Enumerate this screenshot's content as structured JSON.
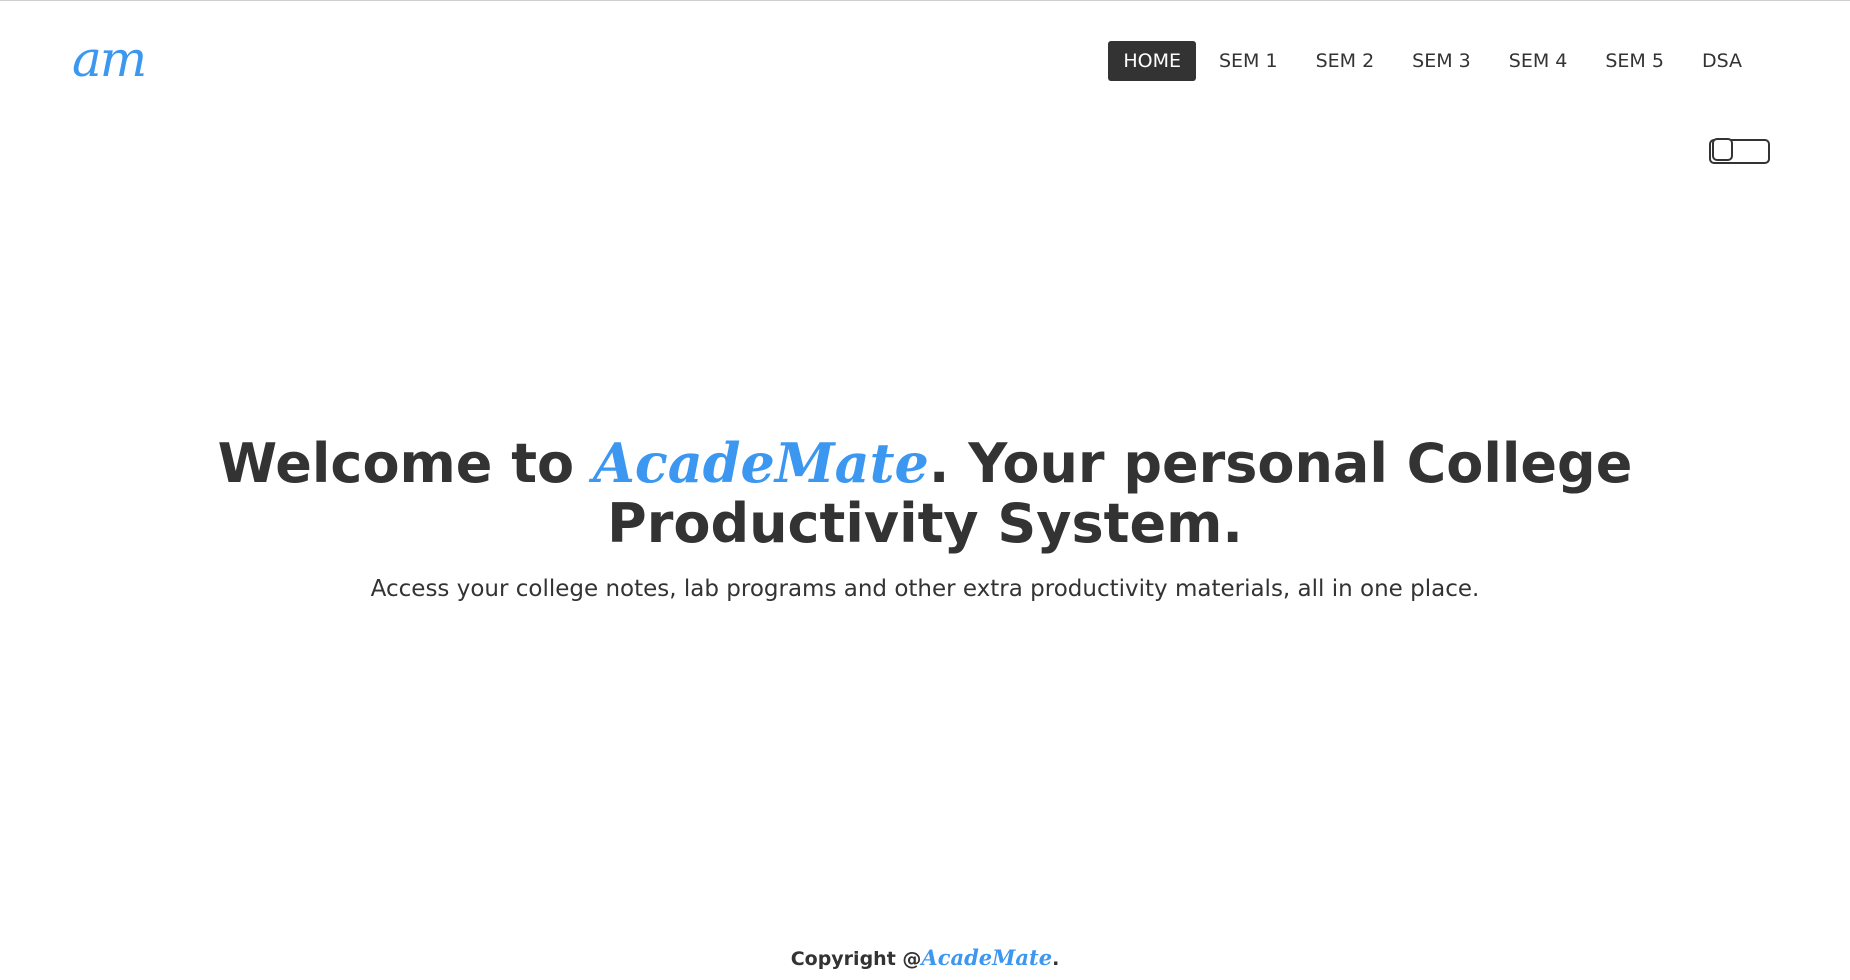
{
  "logo": {
    "text": "am"
  },
  "nav": {
    "items": [
      {
        "label": "HOME",
        "active": true
      },
      {
        "label": "SEM 1",
        "active": false
      },
      {
        "label": "SEM 2",
        "active": false
      },
      {
        "label": "SEM 3",
        "active": false
      },
      {
        "label": "SEM 4",
        "active": false
      },
      {
        "label": "SEM 5",
        "active": false
      },
      {
        "label": "DSA",
        "active": false
      }
    ]
  },
  "theme_toggle": {
    "checked": false
  },
  "hero": {
    "title_prefix": "Welcome to ",
    "brand": "AcadeMate",
    "title_suffix": ". Your personal College Productivity System.",
    "subtitle": "Access your college notes, lab programs and other extra productivity materials, all in one place."
  },
  "footer": {
    "prefix": "Copyright @",
    "brand": "AcadeMate",
    "suffix": "."
  },
  "colors": {
    "brand": "#3b97f0",
    "text": "#333333",
    "active_nav_bg": "#333333",
    "background": "#ffffff"
  }
}
